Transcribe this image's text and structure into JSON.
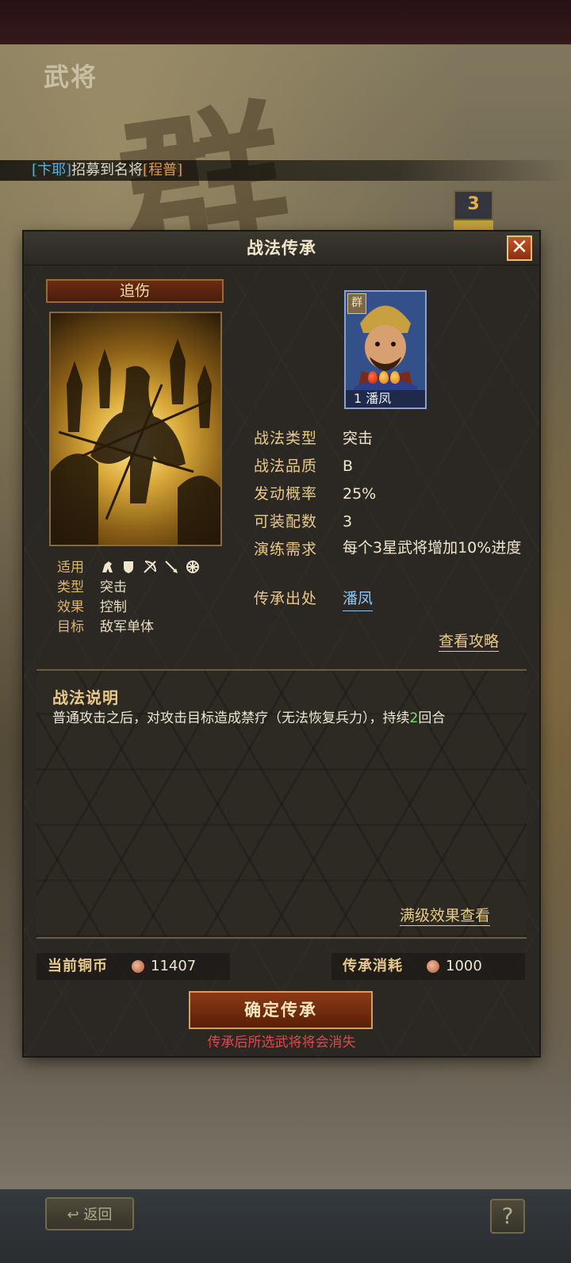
{
  "background": {
    "title": "武将",
    "ticker": {
      "player": "[卞耶]",
      "text": "招募到名将",
      "general": "[程普]"
    },
    "badge": "3",
    "back_label": "返回",
    "help_label": "?"
  },
  "dialog": {
    "title": "战法传承",
    "close": "✕",
    "skill": {
      "name": "追伤",
      "meta": [
        {
          "key": "适用",
          "value": ""
        },
        {
          "key": "类型",
          "value": "突击"
        },
        {
          "key": "效果",
          "value": "控制"
        },
        {
          "key": "目标",
          "value": "敌军单体"
        }
      ],
      "unit_icons": [
        "cavalry-icon",
        "shield-icon",
        "bow-icon",
        "spear-icon",
        "siege-icon"
      ]
    },
    "general": {
      "faction": "群",
      "label": "1 潘凤",
      "stars": 3
    },
    "info": [
      {
        "key": "战法类型",
        "value": "突击"
      },
      {
        "key": "战法品质",
        "value": "B"
      },
      {
        "key": "发动概率",
        "value": "25%"
      },
      {
        "key": "可装配数",
        "value": "3"
      },
      {
        "key": "演练需求",
        "value": "每个3星武将增加10%进度"
      },
      {
        "key": "传承出处",
        "value": "潘凤"
      }
    ],
    "strategy_link": "查看攻略",
    "description": {
      "title": "战法说明",
      "text_before": "普通攻击之后，对攻击目标造成禁疗（无法恢复兵力），持续",
      "highlight": "2",
      "text_after": "回合",
      "full_effect_link": "满级效果查看"
    },
    "currency": {
      "current_label": "当前铜币",
      "current_value": "11407",
      "cost_label": "传承消耗",
      "cost_value": "1000"
    },
    "confirm_label": "确定传承",
    "warning": "传承后所选武将将会消失"
  },
  "colors": {
    "accent_gold": "#e9c98a",
    "warning_red": "#e0484a",
    "link_blue": "#8ec6f0",
    "highlight_green": "#7fe070"
  }
}
